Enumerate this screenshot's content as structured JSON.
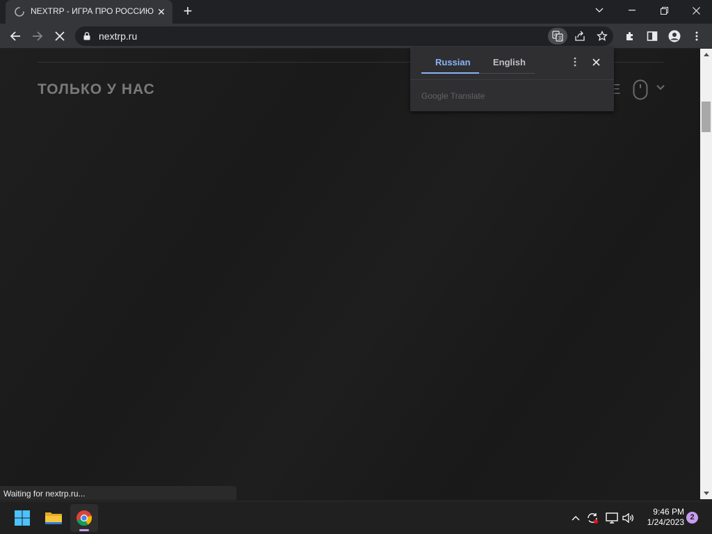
{
  "browser": {
    "tab": {
      "title": "NEXTRP - ИГРА ПРО РОССИЮ",
      "close_glyph": "✕",
      "loading": true
    },
    "new_tab_glyph": "+",
    "address": {
      "url": "nextrp.ru",
      "secure": true
    },
    "toolbar_icons": [
      "back-icon",
      "forward-icon",
      "stop-loading-icon",
      "translate-icon",
      "share-icon",
      "bookmark-star-icon",
      "extensions-icon",
      "side-panel-icon",
      "profile-icon",
      "menu-icon"
    ],
    "window_controls": [
      "tab-search-icon",
      "minimize-icon",
      "restore-icon",
      "close-icon"
    ]
  },
  "page": {
    "heading": "ТОЛЬКО У НАС",
    "partial_text": "Е",
    "icons": [
      "mouse-scroll-icon",
      "chevron-down-icon"
    ]
  },
  "translate_bubble": {
    "tabs": [
      {
        "label": "Russian",
        "selected": true
      },
      {
        "label": "English",
        "selected": false
      }
    ],
    "footer": "Google Translate",
    "accent_color": "#8ab4f8"
  },
  "status_bar": {
    "text": "Waiting for nextrp.ru..."
  },
  "taskbar": {
    "apps": [
      "windows-start-icon",
      "file-explorer-icon",
      "chrome-icon"
    ],
    "tray_icons": [
      "show-hidden-icons-chevron",
      "sync-icon",
      "network-icon",
      "volume-icon"
    ],
    "clock": {
      "time": "9:46 PM",
      "date": "1/24/2023"
    },
    "notification_count": "2",
    "accent_color": "#c79cf0"
  }
}
